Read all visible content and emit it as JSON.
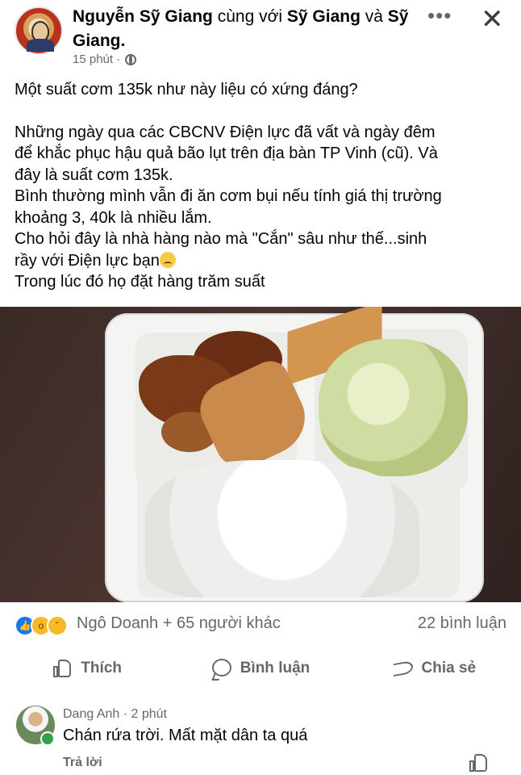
{
  "header": {
    "author": "Nguyễn Sỹ Giang",
    "with_text": "cùng với",
    "tag1": "Sỹ Giang",
    "and_text": "và",
    "tag2": "Sỹ Giang.",
    "time": "15 phút ·",
    "more_icon": "more-dots-icon",
    "close_icon": "close-icon"
  },
  "post": {
    "line1": "Một suất cơm 135k như này liệu có xứng đáng?",
    "para2_l1": "Những ngày qua các CBCNV Điện lực đã vất và ngày đêm",
    "para2_l2": "để khắc phục hậu quả bão lụt trên địa bàn TP Vinh (cũ). Và",
    "para2_l3": "đây là suất cơm 135k.",
    "para3_l1": "Bình thường mình vẫn đi ăn cơm bụi nếu tính giá thị trường",
    "para3_l2": "khoảng 3, 40k là nhiều lắm.",
    "para4_l1": "Cho hỏi đây là nhà hàng nào mà \"Cắn\" sâu như thế...sinh",
    "para4_l2": "rầy với Điện lực bạn",
    "para5": "Trong lúc đó họ đặt hàng trăm suất"
  },
  "reactions": {
    "names": "Ngô Doanh + 65 người khác",
    "comments": "22 bình luận",
    "icons": [
      "like-icon",
      "wow-icon",
      "sad-icon"
    ],
    "like_color": "#1877f2",
    "emoji_color": "#f7b928"
  },
  "actions": {
    "like": "Thích",
    "comment": "Bình luận",
    "share": "Chia sẻ"
  },
  "comment": {
    "name": "Dang Anh",
    "time": "· 2 phút",
    "text": "Chán rứa trời. Mất mặt dân ta quá",
    "reply": "Trả lời",
    "online_color": "#31a24c"
  }
}
